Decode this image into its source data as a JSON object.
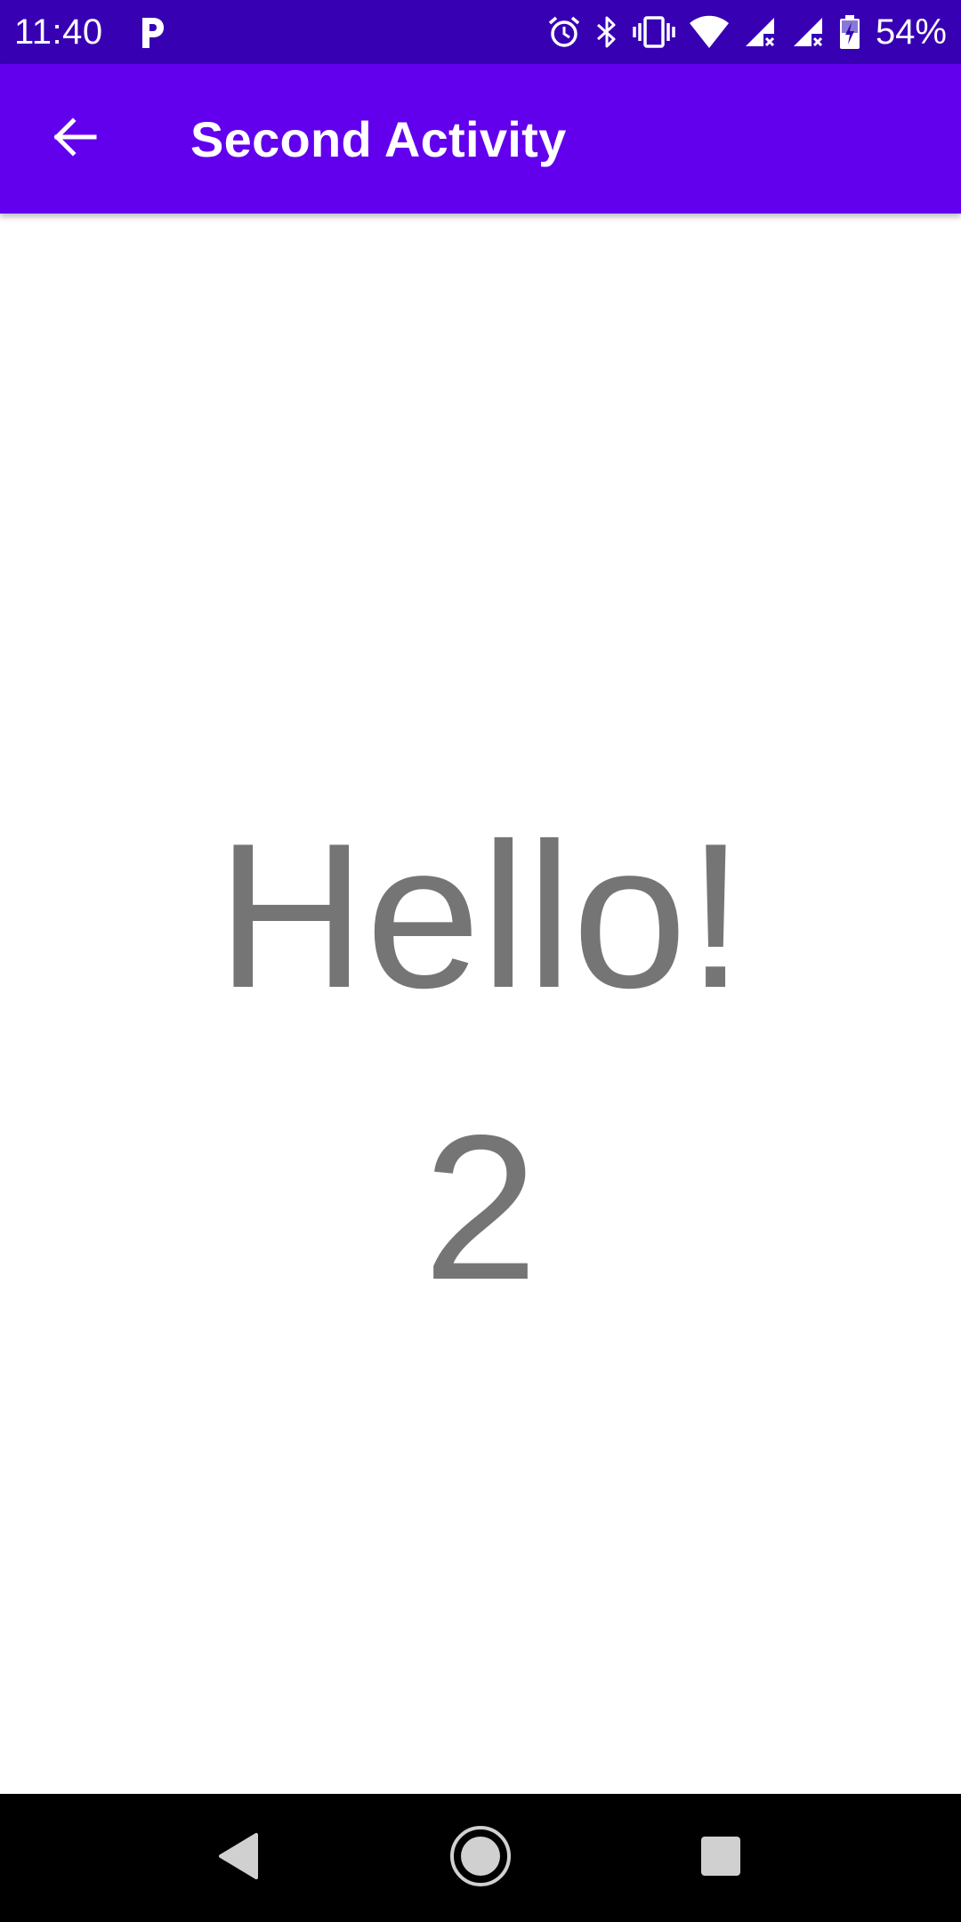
{
  "status_bar": {
    "time": "11:40",
    "notification_icon": "p-icon",
    "icons": [
      "alarm-icon",
      "bluetooth-icon",
      "vibrate-icon",
      "wifi-icon",
      "signal-icon",
      "signal-icon",
      "battery-charging-icon"
    ],
    "battery": "54%"
  },
  "app_bar": {
    "title": "Second Activity",
    "back_icon": "arrow-back-icon"
  },
  "main": {
    "greeting": "Hello!",
    "count": "2"
  },
  "nav_bar": {
    "buttons": [
      "back-triangle-icon",
      "home-circle-icon",
      "recents-square-icon"
    ]
  },
  "colors": {
    "status_bar": "#3700B3",
    "app_bar": "#6200EE",
    "text_gray": "#757575",
    "nav_bar": "#000000"
  }
}
